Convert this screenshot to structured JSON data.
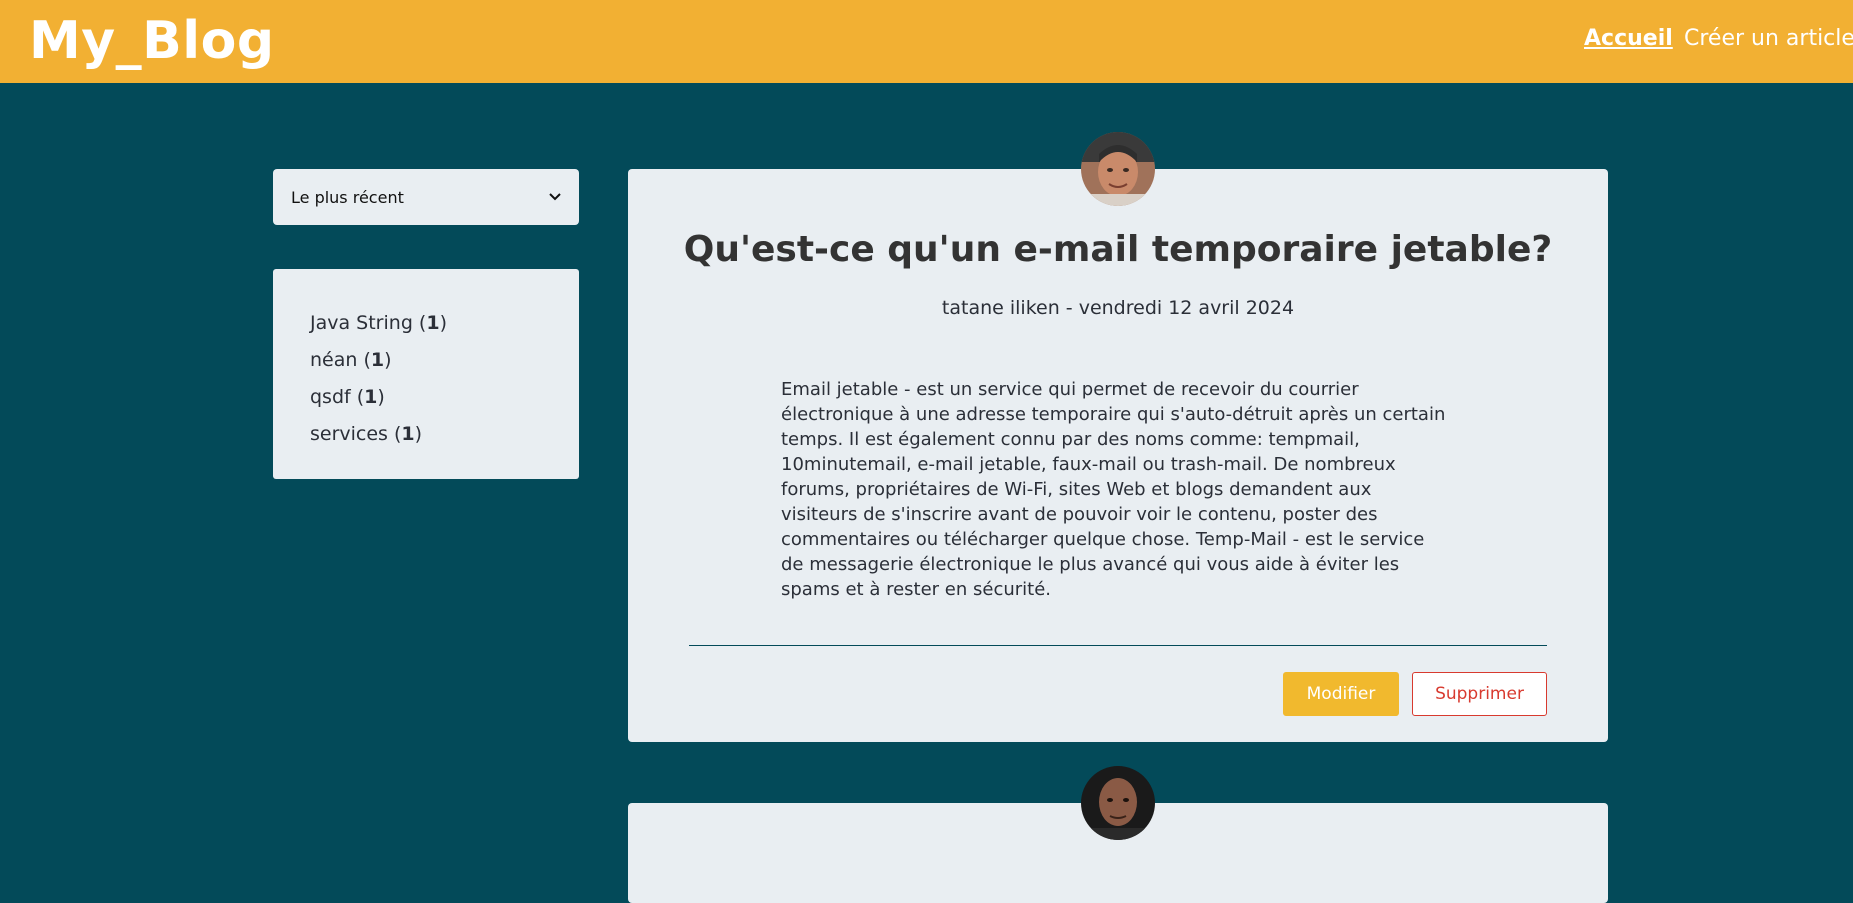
{
  "header": {
    "logo": "My_Blog",
    "nav": {
      "home": "Accueil",
      "create": "Créer un article"
    }
  },
  "sidebar": {
    "sort_select": {
      "value": "Le plus récent"
    },
    "categories": [
      {
        "name": "Java String",
        "count": "1"
      },
      {
        "name": "néan",
        "count": "1"
      },
      {
        "name": "qsdf",
        "count": "1"
      },
      {
        "name": "services",
        "count": "1"
      }
    ]
  },
  "posts": [
    {
      "title": "Qu'est-ce qu'un e-mail temporaire jetable?",
      "meta": "tatane iliken - vendredi 12 avril 2024",
      "body": "Email jetable - est un service qui permet de recevoir du courrier électronique à une adresse temporaire qui s'auto-détruit après un certain temps. Il est également connu par des noms comme: tempmail, 10minutemail, e-mail jetable, faux-mail ou trash-mail. De nombreux forums, propriétaires de Wi-Fi, sites Web et blogs demandent aux visiteurs de s'inscrire avant de pouvoir voir le contenu, poster des commentaires ou télécharger quelque chose. Temp-Mail - est le service de messagerie électronique le plus avancé qui vous aide à éviter les spams et à rester en sécurité.",
      "edit_label": "Modifier",
      "delete_label": "Supprimer"
    }
  ],
  "colors": {
    "header_bg": "#f2b033",
    "page_bg": "#034a59",
    "card_bg": "#e9eef2",
    "edit_button": "#f1b92e",
    "delete_button": "#d83a2f"
  }
}
